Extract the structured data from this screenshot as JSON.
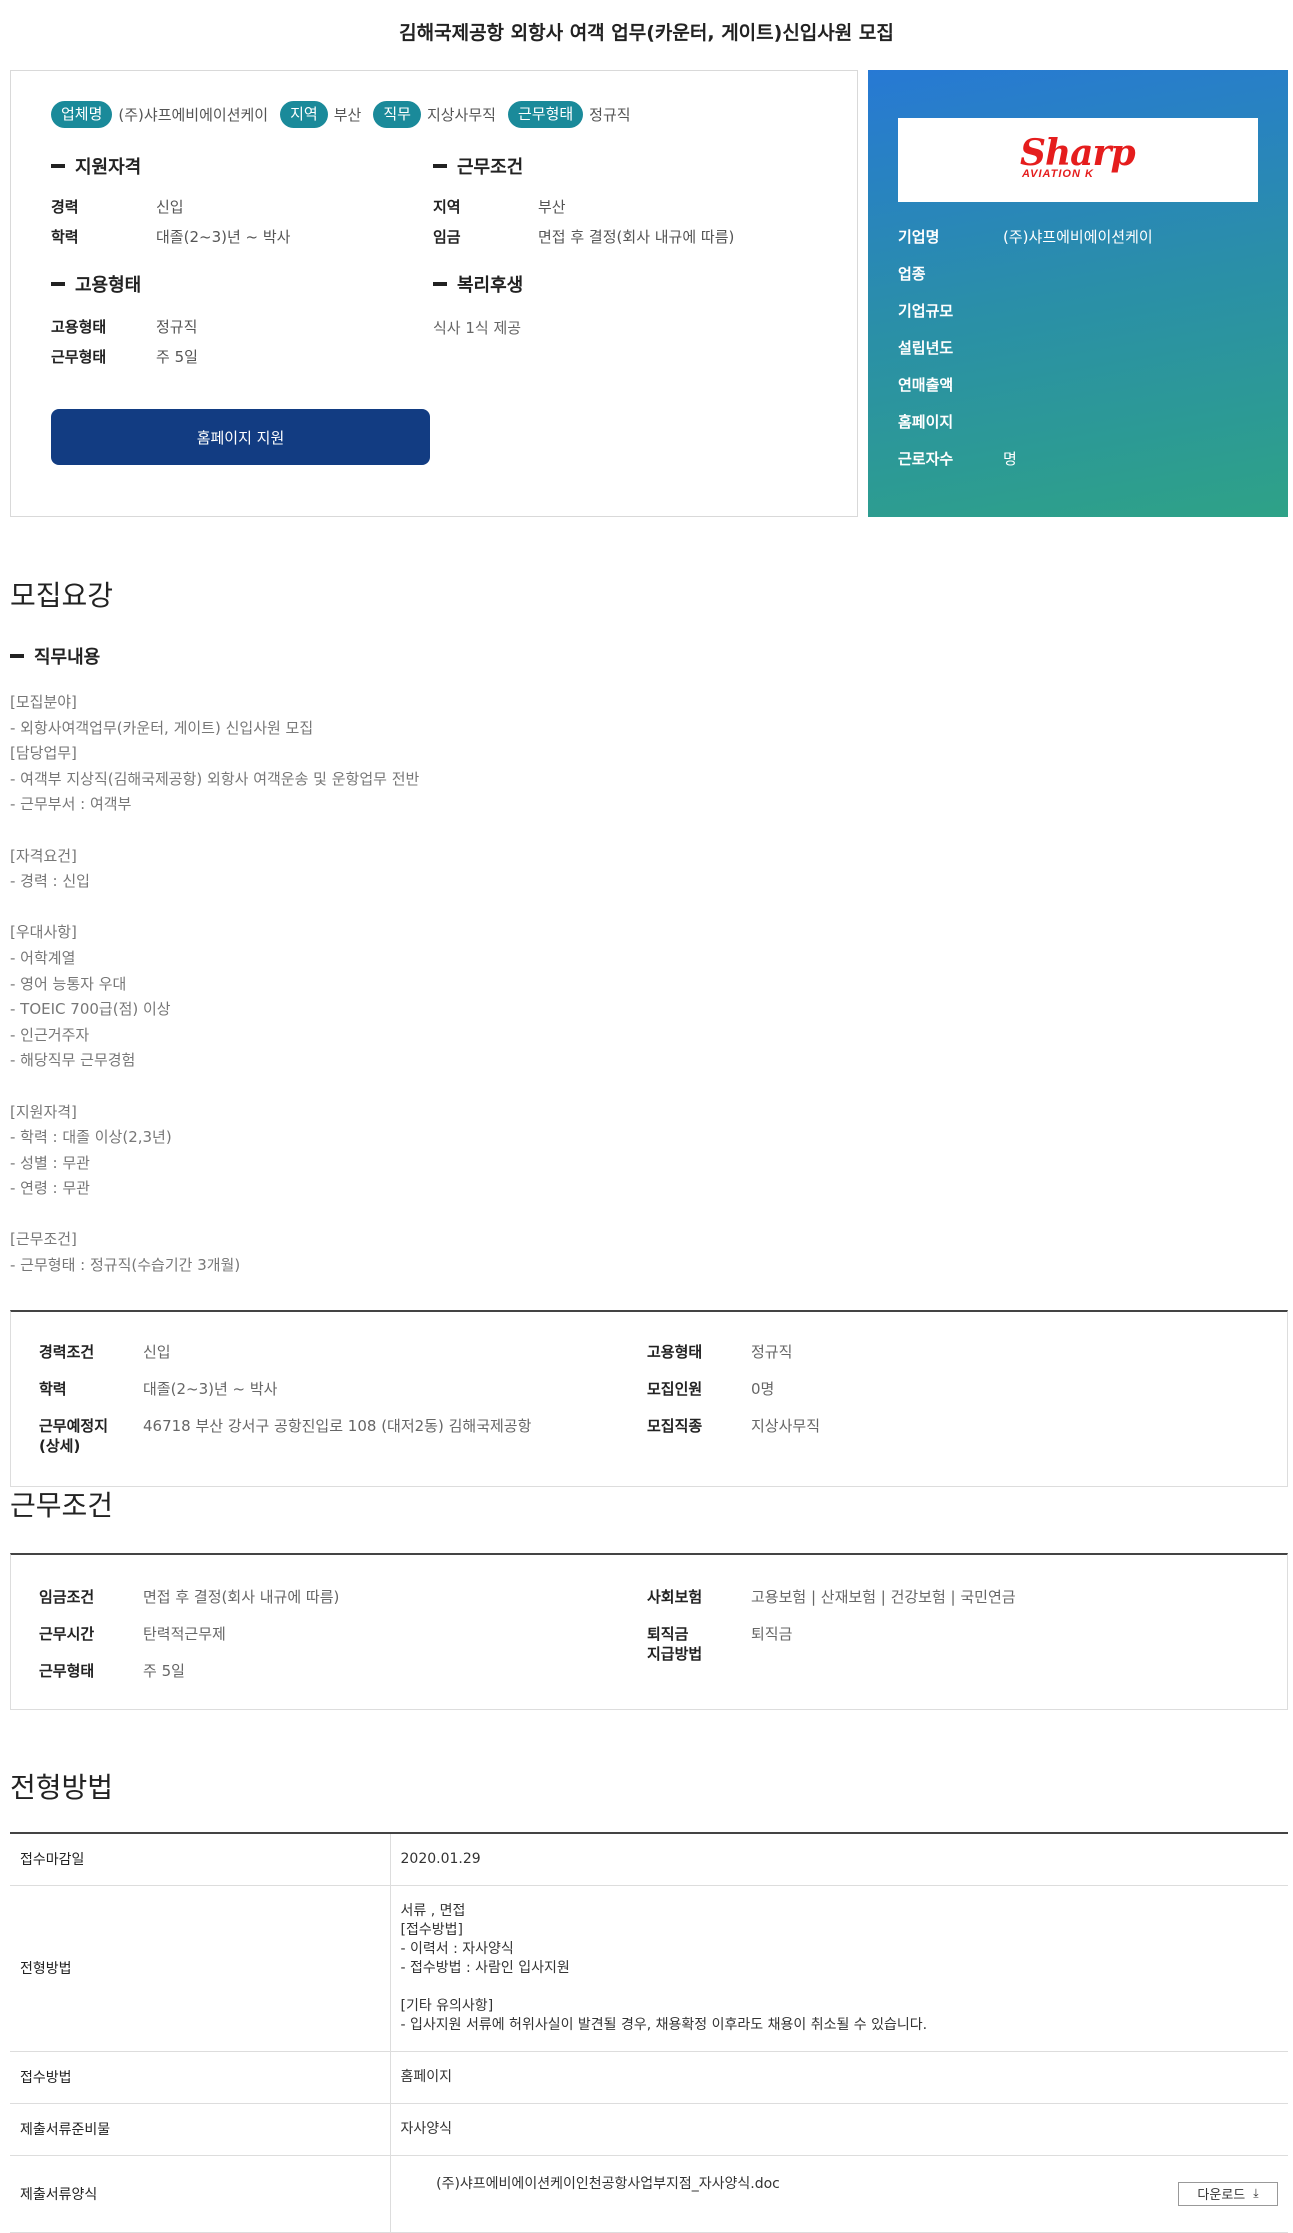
{
  "page": {
    "title": "김해국제공항 외항사 여객 업무(카운터, 게이트)신입사원 모집"
  },
  "tags": [
    {
      "label": "업체명",
      "value": "(주)샤프에비에이션케이"
    },
    {
      "label": "지역",
      "value": "부산"
    },
    {
      "label": "직무",
      "value": "지상사무직"
    },
    {
      "label": "근무형태",
      "value": "정규직"
    }
  ],
  "summary": {
    "qualification": {
      "heading": "지원자격",
      "career_k": "경력",
      "career_v": "신입",
      "edu_k": "학력",
      "edu_v": "대졸(2~3)년 ~ 박사"
    },
    "conditions": {
      "heading": "근무조건",
      "region_k": "지역",
      "region_v": "부산",
      "wage_k": "임금",
      "wage_v": "면접 후 결정(회사 내규에 따름)"
    },
    "employment": {
      "heading": "고용형태",
      "type_k": "고용형태",
      "type_v": "정규직",
      "work_k": "근무형태",
      "work_v": "주 5일"
    },
    "welfare": {
      "heading": "복리후생",
      "text": "식사 1식 제공"
    },
    "apply_label": "홈페이지 지원"
  },
  "company": {
    "logo_text": "Sharp",
    "logo_sub": "AVIATION K",
    "rows": [
      {
        "k": "기업명",
        "v": "(주)샤프에비에이션케이"
      },
      {
        "k": "업종",
        "v": ""
      },
      {
        "k": "기업규모",
        "v": ""
      },
      {
        "k": "설립년도",
        "v": ""
      },
      {
        "k": "연매출액",
        "v": ""
      },
      {
        "k": "홈페이지",
        "v": ""
      },
      {
        "k": "근로자수",
        "v": "명"
      }
    ]
  },
  "recruit": {
    "heading": "모집요강",
    "sub_heading": "직무내용",
    "body": "[모집분야]\n- 외항사여객업무(카운터, 게이트) 신입사원 모집\n[담당업무]\n- 여객부 지상직(김해국제공항) 외항사 여객운송 및 운항업무 전반\n- 근무부서 : 여객부\n\n[자격요건]\n- 경력 : 신입\n\n[우대사항]\n- 어학계열\n- 영어 능통자 우대\n- TOEIC 700급(점) 이상\n- 인근거주자\n- 해당직무 근무경험\n\n[지원자격]\n- 학력 : 대졸 이상(2,3년)\n- 성별 : 무관\n- 연령 : 무관\n\n[근무조건]\n- 근무형태 : 정규직(수습기간 3개월)",
    "info": {
      "career_k": "경력조건",
      "career_v": "신입",
      "emptype_k": "고용형태",
      "emptype_v": "정규직",
      "edu_k": "학력",
      "edu_v": "대졸(2~3)년 ~ 박사",
      "count_k": "모집인원",
      "count_v": "0명",
      "place_k": "근무예정지\n(상세)",
      "place_v": "46718 부산 강서구 공항진입로 108 (대저2동) 김해국제공항",
      "job_k": "모집직종",
      "job_v": "지상사무직"
    }
  },
  "work": {
    "heading": "근무조건",
    "wage_k": "임금조건",
    "wage_v": "면접 후 결정(회사 내규에 따름)",
    "insurance_k": "사회보험",
    "insurance_v": "고용보험 | 산재보험 | 건강보험 | 국민연금",
    "hours_k": "근무시간",
    "hours_v": "탄력적근무제",
    "severance_k": "퇴직금\n지급방법",
    "severance_v": "퇴직금",
    "type_k": "근무형태",
    "type_v": "주 5일"
  },
  "process": {
    "heading": "전형방법",
    "rows": [
      {
        "k": "접수마감일",
        "v": "2020.01.29"
      },
      {
        "k": "전형방법",
        "v": "서류 , 면접\n[접수방법]\n- 이력서 : 자사양식\n- 접수방법 : 사람인 입사지원\n\n[기타 유의사항]\n- 입사지원 서류에 허위사실이 발견될 경우, 채용확정 이후라도 채용이 취소될 수 있습니다."
      },
      {
        "k": "접수방법",
        "v": "홈페이지"
      },
      {
        "k": "제출서류준비물",
        "v": "자사양식"
      },
      {
        "k": "제출서류양식",
        "v": "(주)샤프에비에이션케이인천공항사업부지점_자사양식.doc"
      }
    ],
    "download_label": "다운로드"
  }
}
